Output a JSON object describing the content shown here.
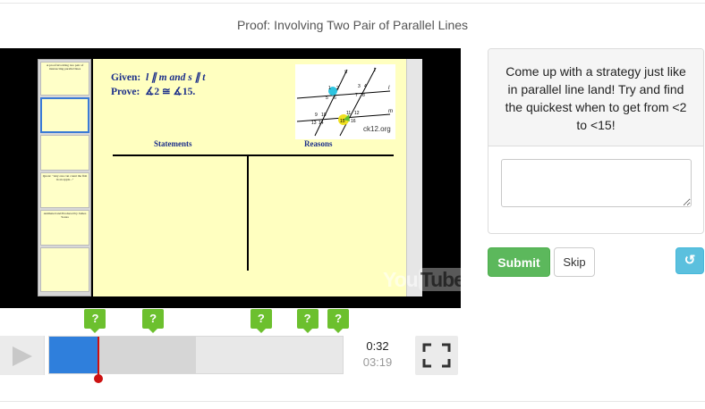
{
  "page": {
    "title": "Proof: Involving Two Pair of Parallel Lines"
  },
  "slide_thumbnails": [
    {
      "text": "A proof involving two pair of intersecting parallel lines"
    },
    {
      "text": ""
    },
    {
      "text": ""
    },
    {
      "text": "Quote: \"Any one can count the fish in an apple...\""
    },
    {
      "text": "Animated and Produced by James Sousa"
    },
    {
      "text": ""
    }
  ],
  "slide": {
    "given_label": "Given:",
    "given_expr": "l ∥ m and s ∥ t",
    "prove_label": "Prove:",
    "prove_expr": "∡2 ≅ ∡15.",
    "site": "ck12.org",
    "statements_header": "Statements",
    "reasons_header": "Reasons",
    "diagram_labels": {
      "s": "s",
      "t": "t",
      "l": "l",
      "m": "m",
      "n1": "1",
      "n2": "2",
      "n3": "3",
      "n4": "4",
      "n5": "5",
      "n6": "6",
      "n7": "7",
      "n8": "8",
      "n9": "9",
      "n10": "10",
      "n11": "11",
      "n12": "12",
      "n13": "13",
      "n14": "14",
      "n15": "15",
      "n16": "16"
    }
  },
  "player": {
    "watermark_a": "You",
    "watermark_b": "Tube",
    "current_time": "0:32",
    "total_time": "03:19",
    "played_fraction": 0.167,
    "buffered_fraction": 0.5,
    "question_markers": [
      {
        "label": "?",
        "position_fraction": 0.16
      },
      {
        "label": "?",
        "position_fraction": 0.357
      },
      {
        "label": "?",
        "position_fraction": 0.725
      },
      {
        "label": "?",
        "position_fraction": 0.883
      },
      {
        "label": "?",
        "position_fraction": 0.988
      }
    ]
  },
  "question": {
    "prompt": "Come up with a strategy just like in parallel line land! Try and find the quickest when to get from <2 to <15!",
    "answer_value": "",
    "submit_label": "Submit",
    "skip_label": "Skip",
    "reset_icon": "↺"
  },
  "colors": {
    "accent_blue": "#2f7fdc",
    "marker_green": "#6cc02e",
    "submit_green": "#5cb85c",
    "reset_cyan": "#5bc0de",
    "playhead_red": "#cc1111"
  }
}
